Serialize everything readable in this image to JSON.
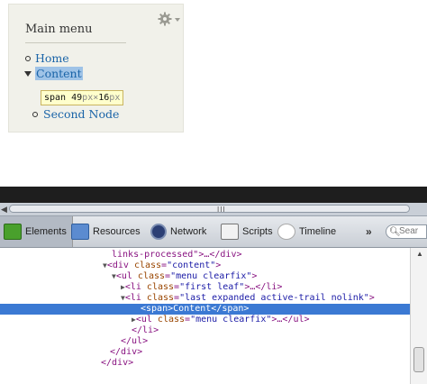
{
  "menu_block": {
    "title": "Main menu",
    "gear_icon": "gear-icon",
    "items": [
      {
        "label": "Home"
      },
      {
        "label": "Content"
      }
    ],
    "sub_item": {
      "label": "Second Node"
    },
    "tooltip": {
      "tag": "span",
      "width": "49",
      "w_unit": "px",
      "sep": "×",
      "height": "16",
      "h_unit": "px"
    }
  },
  "inspector": {
    "hscroll_grip": "III",
    "tabs": [
      {
        "label": "Elements",
        "icon": "elements-icon",
        "selected": true
      },
      {
        "label": "Resources",
        "icon": "resources-icon"
      },
      {
        "label": "Network",
        "icon": "network-icon"
      },
      {
        "label": "Scripts",
        "icon": "scripts-icon"
      },
      {
        "label": "Timeline",
        "icon": "timeline-icon"
      }
    ],
    "more_label": "»",
    "search_placeholder": "Sear",
    "code_lines": [
      {
        "t": "links-processed\">…</div>"
      },
      {
        "t1": "<div ",
        "a": "class",
        "v": "\"content\"",
        "t2": ">"
      },
      {
        "t1": "<ul ",
        "a": "class",
        "v": "\"menu clearfix\"",
        "t2": ">"
      },
      {
        "t1": "<li ",
        "a": "class",
        "v": "\"first leaf\"",
        "t2": ">…</li>"
      },
      {
        "t1": "<li ",
        "a": "class",
        "v": "\"last expanded active-trail nolink\"",
        "t2": ">"
      },
      {
        "t1": "<span>",
        "c": "Content",
        "t2": "</span>"
      },
      {
        "t1": "<ul ",
        "a": "class",
        "v": "\"menu clearfix\"",
        "t2": ">…</ul>"
      },
      {
        "t1": "</li>"
      },
      {
        "t1": "</ul>"
      },
      {
        "t1": "</div>"
      },
      {
        "t1": "</div>"
      }
    ]
  }
}
